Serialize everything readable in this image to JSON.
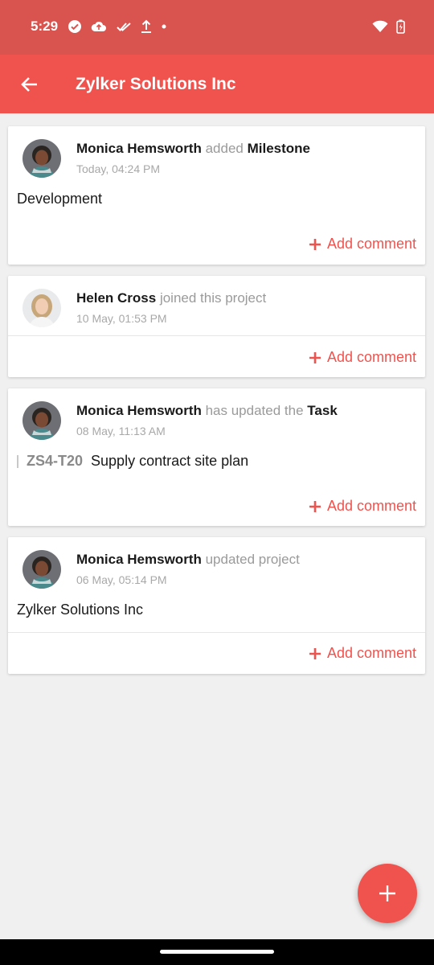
{
  "status": {
    "time": "5:29"
  },
  "appbar": {
    "title": "Zylker Solutions Inc"
  },
  "colors": {
    "accent": "#f0534e",
    "statusbar": "#d9534f"
  },
  "feed": [
    {
      "user": "Monica Hemsworth",
      "action": "added",
      "object": "Milestone",
      "time": "Today, 04:24 PM",
      "text": "Development",
      "comment": "Add comment"
    },
    {
      "user": "Helen Cross",
      "action": "joined this project",
      "object": "",
      "time": "10 May, 01:53 PM",
      "comment": "Add comment"
    },
    {
      "user": "Monica Hemsworth",
      "action": "has updated the",
      "object": "Task",
      "time": "08 May, 11:13 AM",
      "task_id": "ZS4-T20",
      "task_title": "Supply contract site plan",
      "comment": "Add comment"
    },
    {
      "user": "Monica Hemsworth",
      "action": "updated project",
      "object": "",
      "time": "06 May, 05:14 PM",
      "text": "Zylker Solutions Inc",
      "comment": "Add comment"
    }
  ],
  "icons": {
    "back": "arrow-left-icon",
    "fab": "plus-icon",
    "comment": "plus-icon"
  }
}
